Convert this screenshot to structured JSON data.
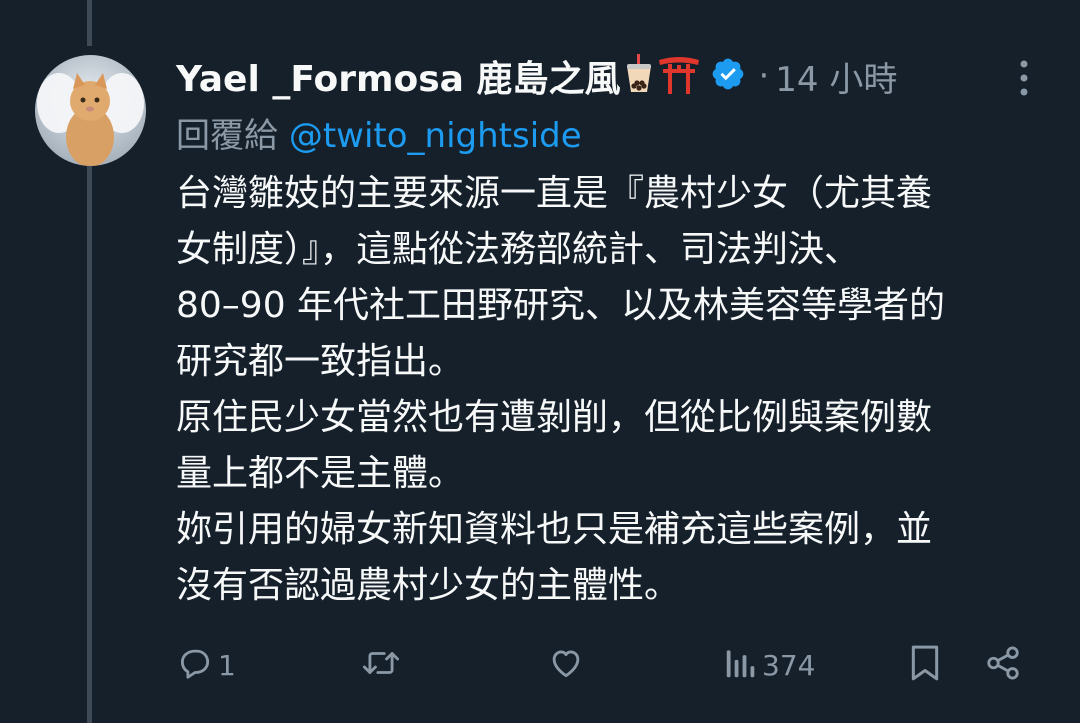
{
  "tweet": {
    "display_name": "Yael _Formosa 鹿島之風",
    "emoji_icons": [
      "bubble-tea-icon",
      "torii-gate-icon"
    ],
    "verified": true,
    "separator": "·",
    "time": "14 小時",
    "reply_prefix": "回覆給",
    "reply_to": "@twito_nightside",
    "lines": [
      "台灣雛妓的主要來源一直是『農村少女（尤其養",
      "女制度）』，這點從法務部統計、司法判決、",
      "80–90 年代社工田野研究、以及林美容等學者的",
      "研究都一致指出。",
      "原住民少女當然也有遭剝削，但從比例與案例數",
      "量上都不是主體。",
      "妳引用的婦女新知資料也只是補充這些案例，並",
      "沒有否認過農村少女的主體性。"
    ]
  },
  "actions": {
    "reply_count": "1",
    "retweet_count": "",
    "like_count": "",
    "views_count": "374"
  },
  "colors": {
    "background": "#15202b",
    "text": "#f7f9f9",
    "muted": "#8b98a5",
    "accent": "#1d9bf0"
  }
}
